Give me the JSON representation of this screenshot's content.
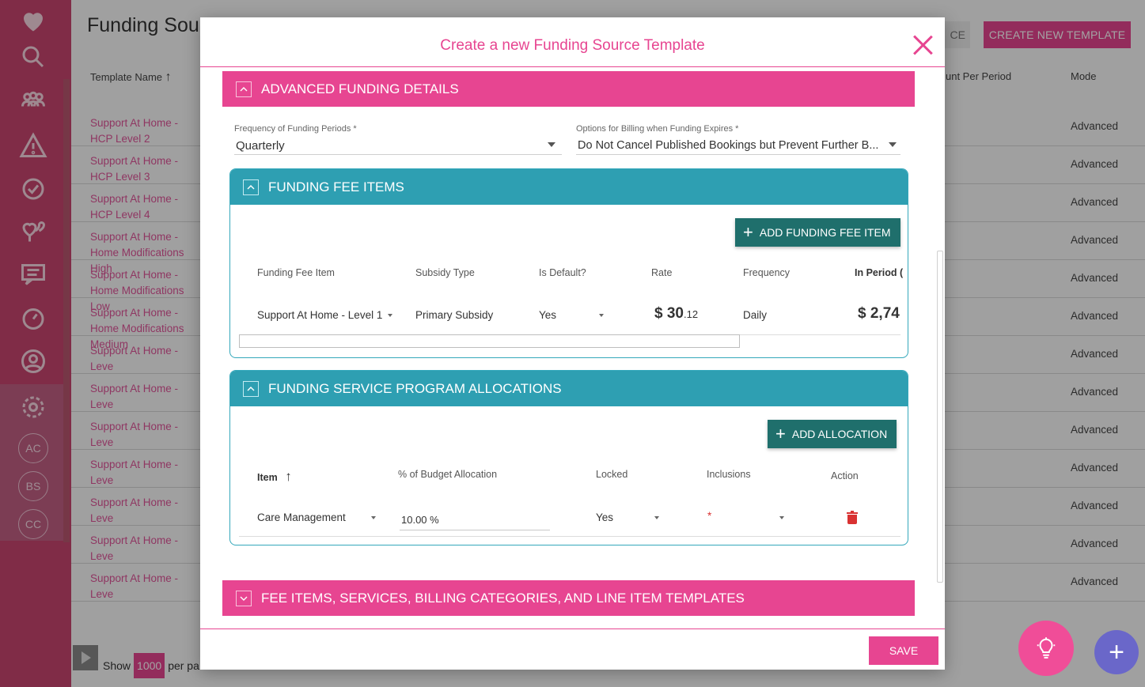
{
  "background": {
    "title": "Funding Sour",
    "ghost_button": "CE",
    "create_button": "CREATE NEW TEMPLATE",
    "columns": {
      "template_name": "Template Name",
      "amount_per_period": "unt Per Period",
      "mode": "Mode"
    },
    "rows": [
      {
        "name": "Support At Home - HCP Level 2",
        "mode": "Advanced"
      },
      {
        "name": "Support At Home - HCP Level 3",
        "mode": "Advanced"
      },
      {
        "name": "Support At Home - HCP Level 4",
        "mode": "Advanced"
      },
      {
        "name": "Support At Home - Home Modifications High",
        "mode": "Advanced"
      },
      {
        "name": "Support At Home - Home Modifications Low",
        "mode": "Advanced"
      },
      {
        "name": "Support At Home - Home Modifications Medium",
        "mode": "Advanced"
      },
      {
        "name": "Support At Home - Leve",
        "mode": "Advanced"
      },
      {
        "name": "Support At Home - Leve",
        "mode": "Advanced"
      },
      {
        "name": "Support At Home - Leve",
        "mode": "Advanced"
      },
      {
        "name": "Support At Home - Leve",
        "mode": "Advanced"
      },
      {
        "name": "Support At Home - Leve",
        "mode": "Advanced"
      },
      {
        "name": "Support At Home - Leve",
        "mode": "Advanced"
      },
      {
        "name": "Support At Home - Leve",
        "mode": "Advanced"
      }
    ],
    "footer": {
      "show": "Show",
      "per_page_value": "1000",
      "per_page": "per pa"
    },
    "sidebar_initials": [
      "AC",
      "BS",
      "CC"
    ]
  },
  "modal": {
    "title": "Create a new Funding Source Template",
    "advanced_section": "ADVANCED FUNDING DETAILS",
    "frequency": {
      "label": "Frequency of Funding Periods *",
      "value": "Quarterly"
    },
    "billing_options": {
      "label": "Options for Billing when Funding Expires *",
      "value": "Do Not Cancel Published Bookings but Prevent Further B..."
    },
    "fee_items": {
      "heading": "FUNDING FEE ITEMS",
      "add_button": "ADD FUNDING FEE ITEM",
      "columns": [
        "Funding Fee Item",
        "Subsidy Type",
        "Is Default?",
        "Rate",
        "Frequency",
        "In Period ("
      ],
      "row": {
        "item": "Support At Home - Level 1",
        "subsidy": "Primary Subsidy",
        "is_default": "Yes",
        "rate_whole": "$ 30",
        "rate_cents": ".12",
        "frequency": "Daily",
        "in_period": "$ 2,74"
      }
    },
    "allocations": {
      "heading": "FUNDING SERVICE PROGRAM ALLOCATIONS",
      "add_button": "ADD ALLOCATION",
      "columns": {
        "item": "Item",
        "budget": "% of Budget Allocation",
        "locked": "Locked",
        "inclusions": "Inclusions",
        "action": "Action"
      },
      "row": {
        "item": "Care Management",
        "budget": "10.00 %",
        "locked": "Yes",
        "inclusions": "*"
      }
    },
    "fee_services_section": "FEE ITEMS, SERVICES, BILLING CATEGORIES, AND LINE ITEM TEMPLATES",
    "save_button": "SAVE"
  },
  "colors": {
    "brand_pink": "#e74591",
    "teal": "#2e9fb2",
    "dark_teal_button": "#1f6f6c",
    "delete_red": "#d93232"
  }
}
